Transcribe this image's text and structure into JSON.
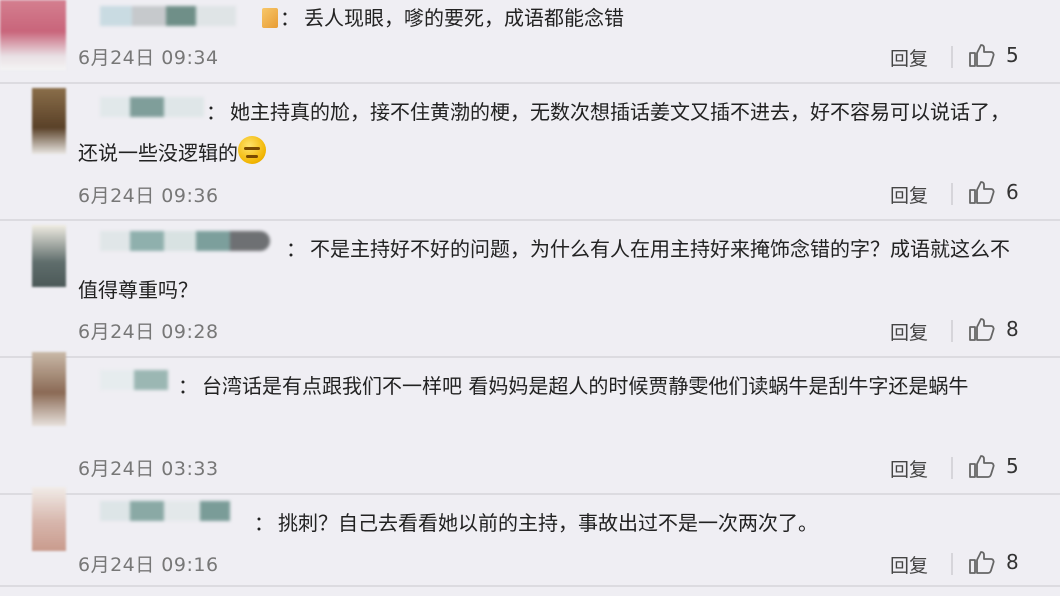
{
  "comments": [
    {
      "text": "丢人现眼，嗲的要死，成语都能念错",
      "time": "6月24日 09:34",
      "reply_label": "回复",
      "likes": "5"
    },
    {
      "text": "她主持真的尬，接不住黄渤的梗，无数次想插话姜文又插不进去，好不容易可以说话了，还说一些没逻辑的",
      "time": "6月24日 09:36",
      "reply_label": "回复",
      "likes": "6"
    },
    {
      "text": "不是主持好不好的问题，为什么有人在用主持好来掩饰念错的字？成语就这么不值得尊重吗？",
      "time": "6月24日 09:28",
      "reply_label": "回复",
      "likes": "8"
    },
    {
      "text": "台湾话是有点跟我们不一样吧 看妈妈是超人的时候贾静雯他们读蜗牛是刮牛字还是蜗牛",
      "time": "6月24日 03:33",
      "reply_label": "回复",
      "likes": "5"
    },
    {
      "text": "挑刺？自己去看看她以前的主持，事故出过不是一次两次了。",
      "time": "6月24日 09:16",
      "reply_label": "回复",
      "likes": "8"
    }
  ],
  "separator": "：",
  "icons": {
    "like": "thumbs-up-icon",
    "emoji": "smirk-emoji-icon",
    "prefix": "user-badge-icon"
  },
  "colors": {
    "background": "#efeef3",
    "divider": "#dcdbe0",
    "time": "#777777"
  }
}
